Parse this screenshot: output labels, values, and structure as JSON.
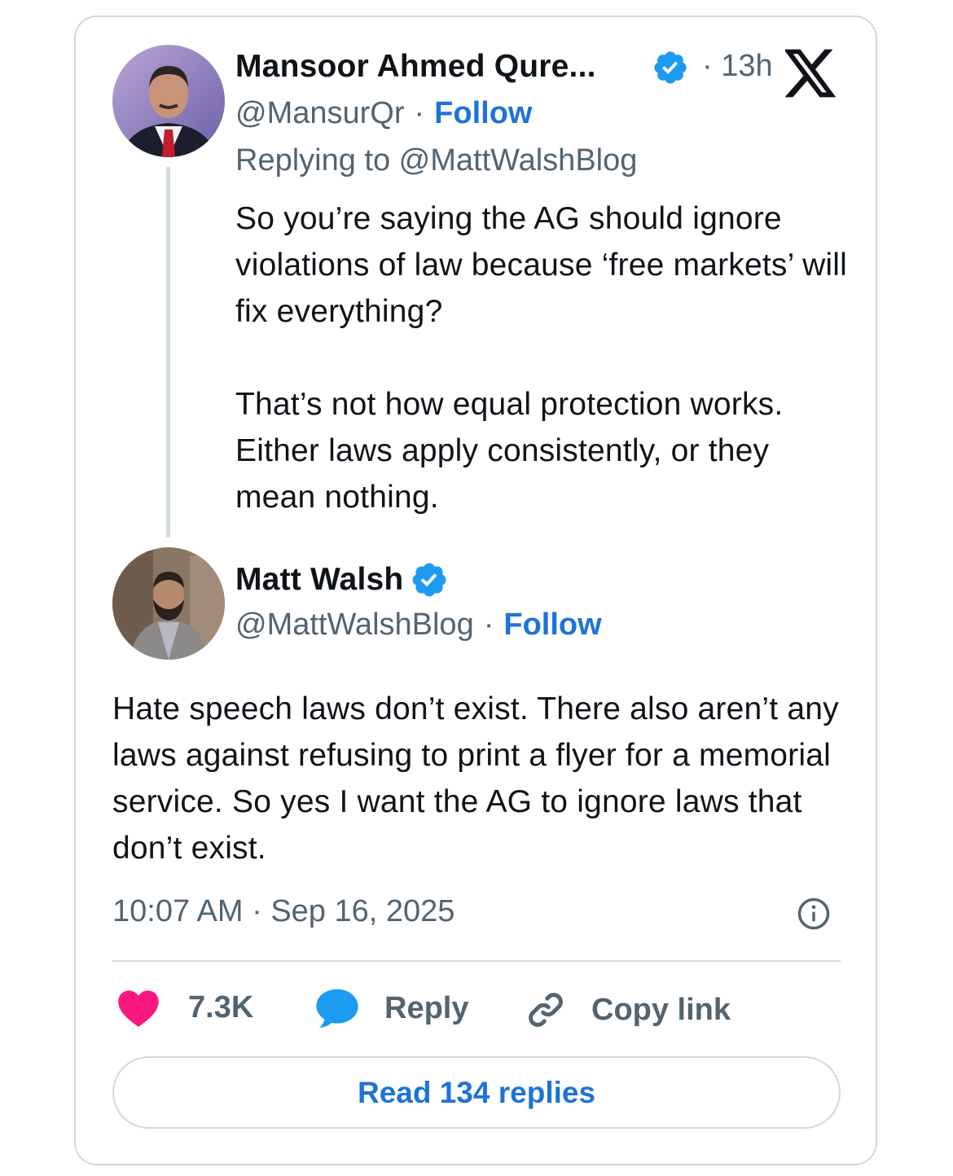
{
  "reply_tweet": {
    "author_name": "Mansoor Ahmed Qure...",
    "handle": "@MansurQr",
    "separator": "·",
    "follow_label": "Follow",
    "time_ago": "· 13h",
    "replying_to": "Replying to @MattWalshBlog",
    "text_paragraph_1": "So you’re saying the AG should ignore violations of law because ‘free markets’ will fix everything?",
    "text_paragraph_2": "That’s not how equal protection works. Either laws apply consistently, or they mean nothing."
  },
  "main_tweet": {
    "author_name": "Matt Walsh",
    "handle": "@MattWalshBlog",
    "separator": "·",
    "follow_label": "Follow",
    "text": "Hate speech laws don’t exist. There also aren’t any laws against refusing to print a flyer for a memorial service. So yes I want the AG to ignore laws that don’t exist.",
    "timestamp": "10:07 AM · Sep 16, 2025"
  },
  "actions": {
    "like_count": "7.3K",
    "reply_label": "Reply",
    "copy_link_label": "Copy link"
  },
  "read_replies_label": "Read 134 replies",
  "icons": {
    "verified": "verified-badge-icon",
    "platform": "x-logo-icon",
    "like": "heart-icon",
    "reply": "speech-bubble-icon",
    "copy": "link-icon",
    "info": "info-icon"
  },
  "colors": {
    "verified_blue": "#1d9bf0",
    "follow_blue": "#1d74d6",
    "heart_pink": "#f91880",
    "muted_text": "#536471",
    "border": "#cfd9de"
  }
}
